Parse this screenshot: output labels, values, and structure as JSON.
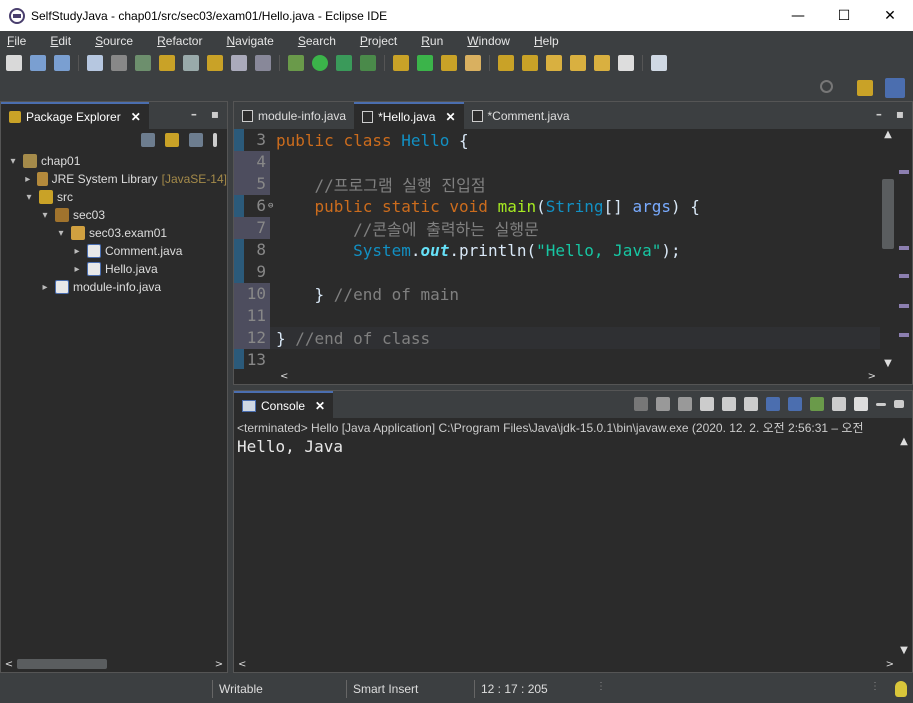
{
  "window": {
    "title": "SelfStudyJava - chap01/src/sec03/exam01/Hello.java - Eclipse IDE",
    "controls": {
      "minimize": "—",
      "maximize": "☐",
      "close": "✕"
    }
  },
  "menu": [
    "File",
    "Edit",
    "Source",
    "Refactor",
    "Navigate",
    "Search",
    "Project",
    "Run",
    "Window",
    "Help"
  ],
  "package_explorer": {
    "tab_label": "Package Explorer",
    "close": "✕",
    "tree": [
      {
        "label": "chap01",
        "arrow": "▾",
        "indent": 0,
        "icon": "project"
      },
      {
        "label": "JRE System Library",
        "decor": "[JavaSE-14]",
        "arrow": "▸",
        "indent": 1,
        "icon": "jre"
      },
      {
        "label": "src",
        "arrow": "▾",
        "indent": 1,
        "icon": "folder"
      },
      {
        "label": "sec03",
        "arrow": "▾",
        "indent": 2,
        "icon": "pkgi"
      },
      {
        "label": "sec03.exam01",
        "arrow": "▾",
        "indent": 3,
        "icon": "pkgo"
      },
      {
        "label": "Comment.java",
        "arrow": "▸",
        "indent": 4,
        "icon": "java"
      },
      {
        "label": "Hello.java",
        "arrow": "▸",
        "indent": 4,
        "icon": "java"
      },
      {
        "label": "module-info.java",
        "arrow": "▸",
        "indent": 2,
        "icon": "java"
      }
    ]
  },
  "editor": {
    "tabs": [
      {
        "label": "module-info.java",
        "active": false
      },
      {
        "label": "*Hello.java",
        "active": true,
        "close": "✕"
      },
      {
        "label": "*Comment.java",
        "active": false
      }
    ],
    "lines": [
      {
        "num": "3",
        "html": "<span class=\"kw\">public</span> <span class=\"kw\">class</span> <span class=\"cls\">Hello</span> {"
      },
      {
        "num": "4",
        "html": ""
      },
      {
        "num": "5",
        "html": "    <span class=\"cmt\">//프로그램 실행 진입점</span>"
      },
      {
        "num": "6",
        "html": "    <span class=\"kw\">public</span> <span class=\"kw\">static</span> <span class=\"kw\">void</span> <span class=\"meth\">main</span>(<span class=\"cls\">String</span>[] <span class=\"par\">args</span>) {",
        "fold": "⊖"
      },
      {
        "num": "7",
        "html": "        <span class=\"cmt\">//콘솔에 출력하는 실행문</span>"
      },
      {
        "num": "8",
        "html": "        <span class=\"cls\">System</span>.<span class=\"fld\">out</span>.println(<span class=\"str\">\"Hello, Java\"</span>);"
      },
      {
        "num": "9",
        "html": ""
      },
      {
        "num": "10",
        "html": "    } <span class=\"cmt\">//end of main</span>"
      },
      {
        "num": "11",
        "html": ""
      },
      {
        "num": "12",
        "html": "} <span class=\"cmt\">//end of class</span>"
      },
      {
        "num": "13",
        "html": ""
      }
    ]
  },
  "console": {
    "tab_label": "Console",
    "close": "✕",
    "header": "<terminated> Hello [Java Application] C:\\Program Files\\Java\\jdk-15.0.1\\bin\\javaw.exe  (2020. 12. 2. 오전 2:56:31 – 오전",
    "output": "Hello, Java"
  },
  "statusbar": {
    "writable": "Writable",
    "insert_mode": "Smart Insert",
    "position": "12 : 17 : 205"
  },
  "colors": {
    "accent": "#4b6eaf",
    "keyword": "#cc6c1d",
    "class": "#1290c3",
    "comment": "#808080",
    "string": "#17c6a3"
  }
}
